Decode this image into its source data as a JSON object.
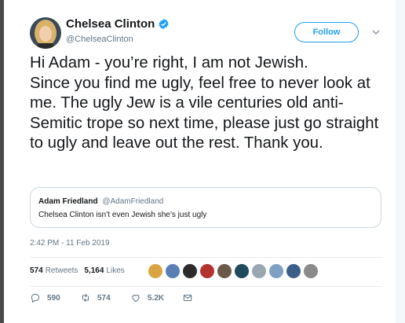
{
  "author": {
    "display_name": "Chelsea Clinton",
    "handle": "@ChelseaClinton",
    "verified": true
  },
  "follow_label": "Follow",
  "tweet_text": "Hi Adam - you’re right, I am not Jewish.\nSince you find me ugly, feel free to never look at me. The ugly Jew is a vile centuries old anti-Semitic trope so next time, please just go straight to ugly and leave out the rest. Thank you.",
  "quoted_tweet": {
    "name": "Adam Friedland",
    "handle": "@AdamFriedland",
    "text": "Chelsea Clinton isn’t even Jewish she’s just ugly"
  },
  "timestamp": "2:42 PM - 11 Feb 2019",
  "stats": {
    "retweets_count": "574",
    "retweets_label": "Retweets",
    "likes_count": "5,164",
    "likes_label": "Likes"
  },
  "liker_avatars": [
    {
      "color": "#d9a441"
    },
    {
      "color": "#5a7fb5"
    },
    {
      "color": "#2b2b2b"
    },
    {
      "color": "#b5322e"
    },
    {
      "color": "#6b5a4a"
    },
    {
      "color": "#1f4b5c"
    },
    {
      "color": "#9aa7b3"
    },
    {
      "color": "#7ea0c4"
    },
    {
      "color": "#3b5f8a"
    },
    {
      "color": "#8a8a8a"
    }
  ],
  "actions": {
    "reply_count": "590",
    "retweet_count": "574",
    "like_count": "5.2K"
  },
  "colors": {
    "accent": "#1da1f2",
    "text": "#14171a",
    "secondary": "#657786",
    "border": "#ccd6dd"
  }
}
